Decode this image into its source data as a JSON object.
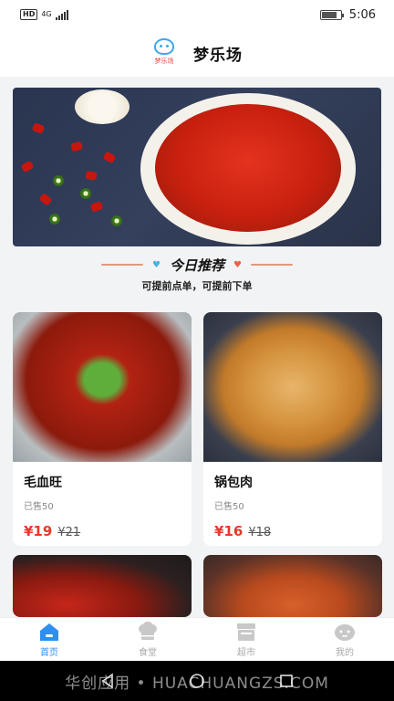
{
  "status_bar": {
    "hd": "HD",
    "network": "4G",
    "time": "5:06"
  },
  "header": {
    "logo_text": "梦乐场",
    "title": "梦乐场"
  },
  "section": {
    "title": "今日推荐",
    "subtitle": "可提前点单，可提前下单"
  },
  "dishes": [
    {
      "name": "毛血旺",
      "sold": "已售50",
      "price": "¥19",
      "original_price": "¥21"
    },
    {
      "name": "锅包肉",
      "sold": "已售50",
      "price": "¥16",
      "original_price": "¥18"
    }
  ],
  "tabs": [
    {
      "label": "首页",
      "icon": "home-icon",
      "active": true
    },
    {
      "label": "食堂",
      "icon": "chef-hat-icon",
      "active": false
    },
    {
      "label": "超市",
      "icon": "store-icon",
      "active": false
    },
    {
      "label": "我的",
      "icon": "profile-icon",
      "active": false
    }
  ],
  "watermark": "华创应用 • HUACHUANGZS.COM",
  "colors": {
    "accent": "#2f8ff0",
    "price": "#e8382a"
  }
}
